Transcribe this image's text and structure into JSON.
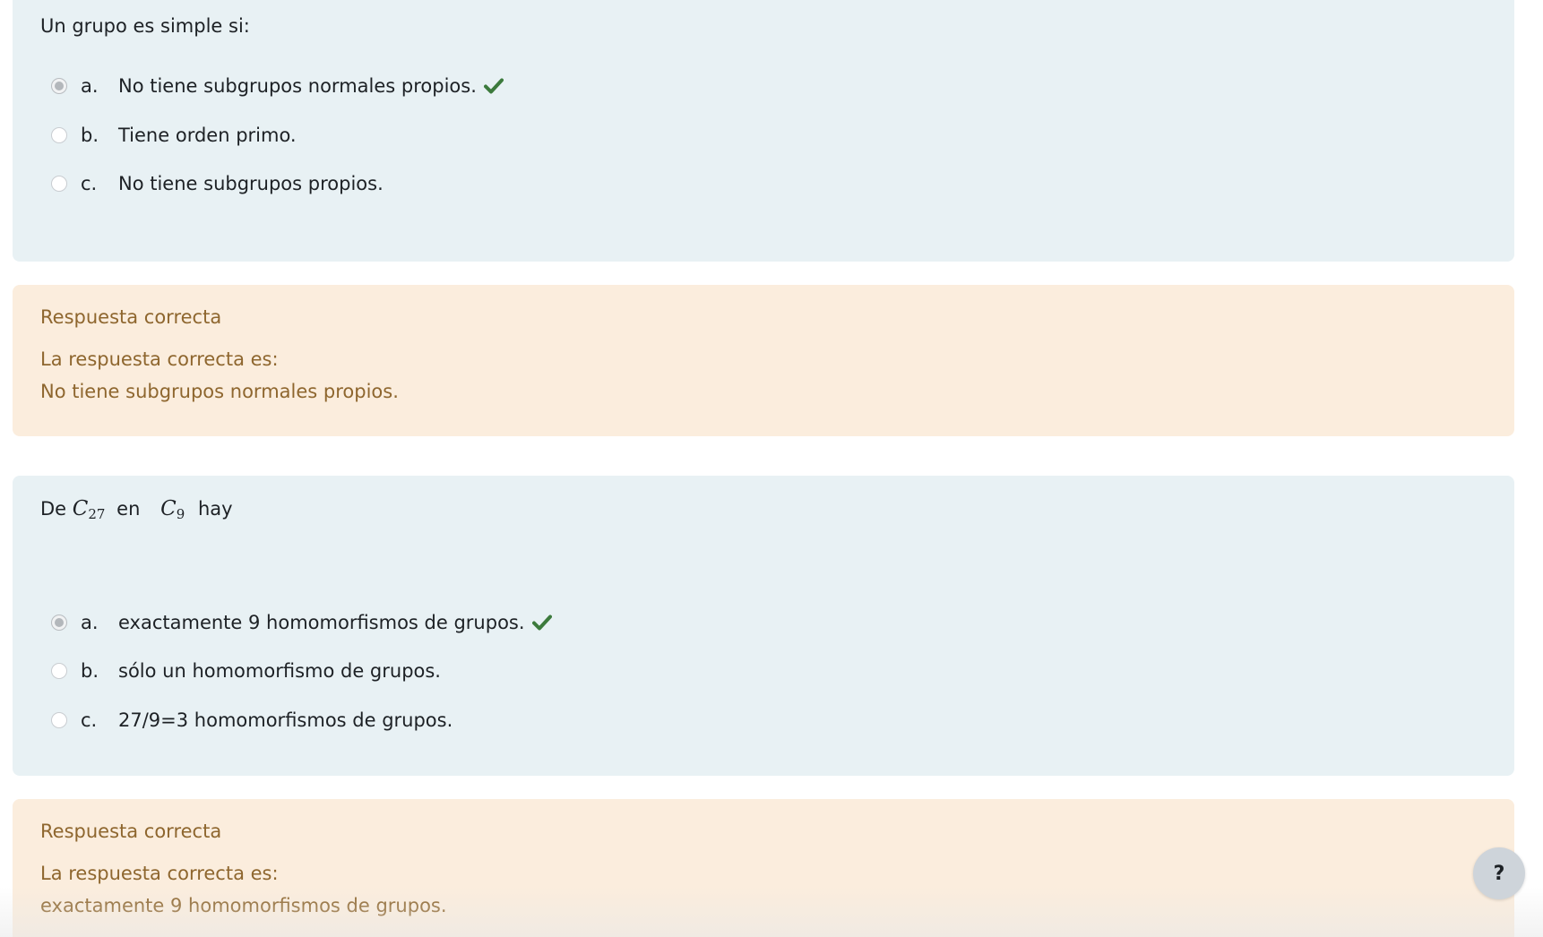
{
  "question1": {
    "prompt": "Un grupo es simple si:",
    "options": [
      {
        "letter": "a.",
        "text": "No tiene subgrupos normales propios.",
        "selected": true,
        "correct": true
      },
      {
        "letter": "b.",
        "text": "Tiene orden primo.",
        "selected": false,
        "correct": false
      },
      {
        "letter": "c.",
        "text": "No tiene subgrupos propios.",
        "selected": false,
        "correct": false
      }
    ]
  },
  "feedback1": {
    "status": "Respuesta correcta",
    "answer_label": "La respuesta correcta es:",
    "answer_text": "No tiene subgrupos normales propios."
  },
  "question2": {
    "prompt_prefix": "De",
    "group1_symbol": "C",
    "group1_sub": "27",
    "prompt_mid": "en",
    "group2_symbol": "C",
    "group2_sub": "9",
    "prompt_suffix": "hay",
    "options": [
      {
        "letter": "a.",
        "text": "exactamente 9 homomorfismos de grupos.",
        "selected": true,
        "correct": true
      },
      {
        "letter": "b.",
        "text": "sólo un homomorfismo de grupos.",
        "selected": false,
        "correct": false
      },
      {
        "letter": "c.",
        "text": "27/9=3 homomorfismos de grupos.",
        "selected": false,
        "correct": false
      }
    ]
  },
  "feedback2": {
    "status": "Respuesta correcta",
    "answer_label": "La respuesta correcta es:",
    "answer_text": "exactamente 9 homomorfismos de grupos."
  },
  "help_button": {
    "label": "?"
  },
  "colors": {
    "question_bg": "#e8f1f4",
    "feedback_bg": "#fbeddd",
    "feedback_text": "#8e662e",
    "check_green": "#3c7a3c"
  },
  "icons": {
    "correct": "check-icon"
  }
}
